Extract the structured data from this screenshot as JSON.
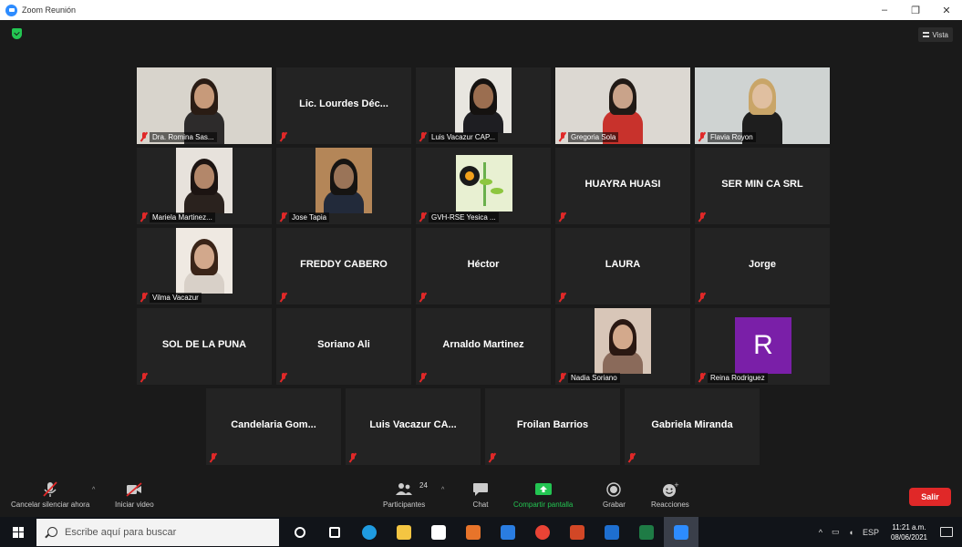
{
  "window": {
    "title": "Zoom Reunión",
    "buttons": [
      "–",
      "❐",
      "✕"
    ]
  },
  "view_label": "Vista",
  "participants": [
    {
      "label": "Dra. Romina Sas...",
      "video": true,
      "active": false,
      "skin": "#c79a7a",
      "hair": "#2a1c14",
      "bg": "#d8d4cc",
      "shirt": "#2d2b2b"
    },
    {
      "name": "Lic. Lourdes Déc...",
      "video": false
    },
    {
      "label": "Luis Vacazur CAP...",
      "video": true,
      "skin": "#9b6e50",
      "hair": "#151210",
      "bg": "#e8e6e0",
      "shirt": "#1e1e22"
    },
    {
      "label": "Gregoria Sola",
      "video": true,
      "skin": "#c9a38a",
      "hair": "#211a16",
      "bg": "#dcd8d2",
      "shirt": "#c8322c"
    },
    {
      "label": "Flavia Royon",
      "video": true,
      "active": true,
      "skin": "#e0bfa0",
      "hair": "#c9a568",
      "bg": "#cfd3d2",
      "shirt": "#1e1e1e"
    },
    {
      "label": "Mariela Martinez...",
      "video": true,
      "skin": "#b3876a",
      "hair": "#1c1412",
      "bg": "#e7e2dc",
      "shirt": "#2a221e"
    },
    {
      "label": "Jose Tapia",
      "video": true,
      "skin": "#9a7458",
      "hair": "#161412",
      "bg": "#b48658",
      "shirt": "#222a3a"
    },
    {
      "label": "GVH-RSE Yesica ...",
      "video": true,
      "logo": true
    },
    {
      "name": "HUAYRA HUASI",
      "video": false
    },
    {
      "name": "SER MIN CA SRL",
      "video": false
    },
    {
      "label": "Vilma Vacazur",
      "video": true,
      "skin": "#d2a88c",
      "hair": "#3a2418",
      "bg": "#efe9e2",
      "shirt": "#d8d0c8"
    },
    {
      "name": "FREDDY CABERO",
      "video": false
    },
    {
      "name": "Héctor",
      "video": false
    },
    {
      "name": "LAURA",
      "video": false
    },
    {
      "name": "Jorge",
      "video": false
    },
    {
      "name": "SOL DE LA PUNA",
      "video": false
    },
    {
      "name": "Soriano Ali",
      "video": false
    },
    {
      "name": "Arnaldo Martinez",
      "video": false
    },
    {
      "label": "Nadia Soriano",
      "video": true,
      "skin": "#d3a98c",
      "hair": "#2a1812",
      "bg": "#d8c6b8",
      "shirt": "#8a6a5a"
    },
    {
      "label": "Reina Rodriguez",
      "video": false,
      "avatar": "R"
    },
    {
      "name": "Candelaria  Gom...",
      "video": false
    },
    {
      "name": "Luis Vacazur CA...",
      "video": false
    },
    {
      "name": "Froilan Barrios",
      "video": false
    },
    {
      "name": "Gabriela Miranda",
      "video": false
    }
  ],
  "toolbar": {
    "mute_label": "Cancelar silenciar ahora",
    "video_label": "Iniciar video",
    "participants_label": "Participantes",
    "participants_count": "24",
    "chat_label": "Chat",
    "share_label": "Compartir pantalla",
    "record_label": "Grabar",
    "reactions_label": "Reacciones",
    "end_label": "Salir",
    "caret": "^",
    "accent_share": "#23c552",
    "end_color": "#e02828"
  },
  "taskbar": {
    "search_placeholder": "Escribe aquí para buscar",
    "lang": "ESP",
    "time": "11:21 a.m.",
    "date": "08/06/2021",
    "apps": [
      {
        "name": "task-view",
        "color": "#ffffff"
      },
      {
        "name": "widgets",
        "color": "#ffffff"
      },
      {
        "name": "edge",
        "color": "#1f9be0"
      },
      {
        "name": "file-explorer",
        "color": "#f4c542"
      },
      {
        "name": "store",
        "color": "#ffffff"
      },
      {
        "name": "media-player",
        "color": "#e8742a"
      },
      {
        "name": "mail",
        "color": "#2a7de1"
      },
      {
        "name": "chrome",
        "color": "#e94335"
      },
      {
        "name": "powerpoint",
        "color": "#d24726"
      },
      {
        "name": "outlook",
        "color": "#1e6fd0"
      },
      {
        "name": "excel",
        "color": "#1e7b45"
      },
      {
        "name": "zoom",
        "color": "#2d8cff"
      }
    ]
  }
}
